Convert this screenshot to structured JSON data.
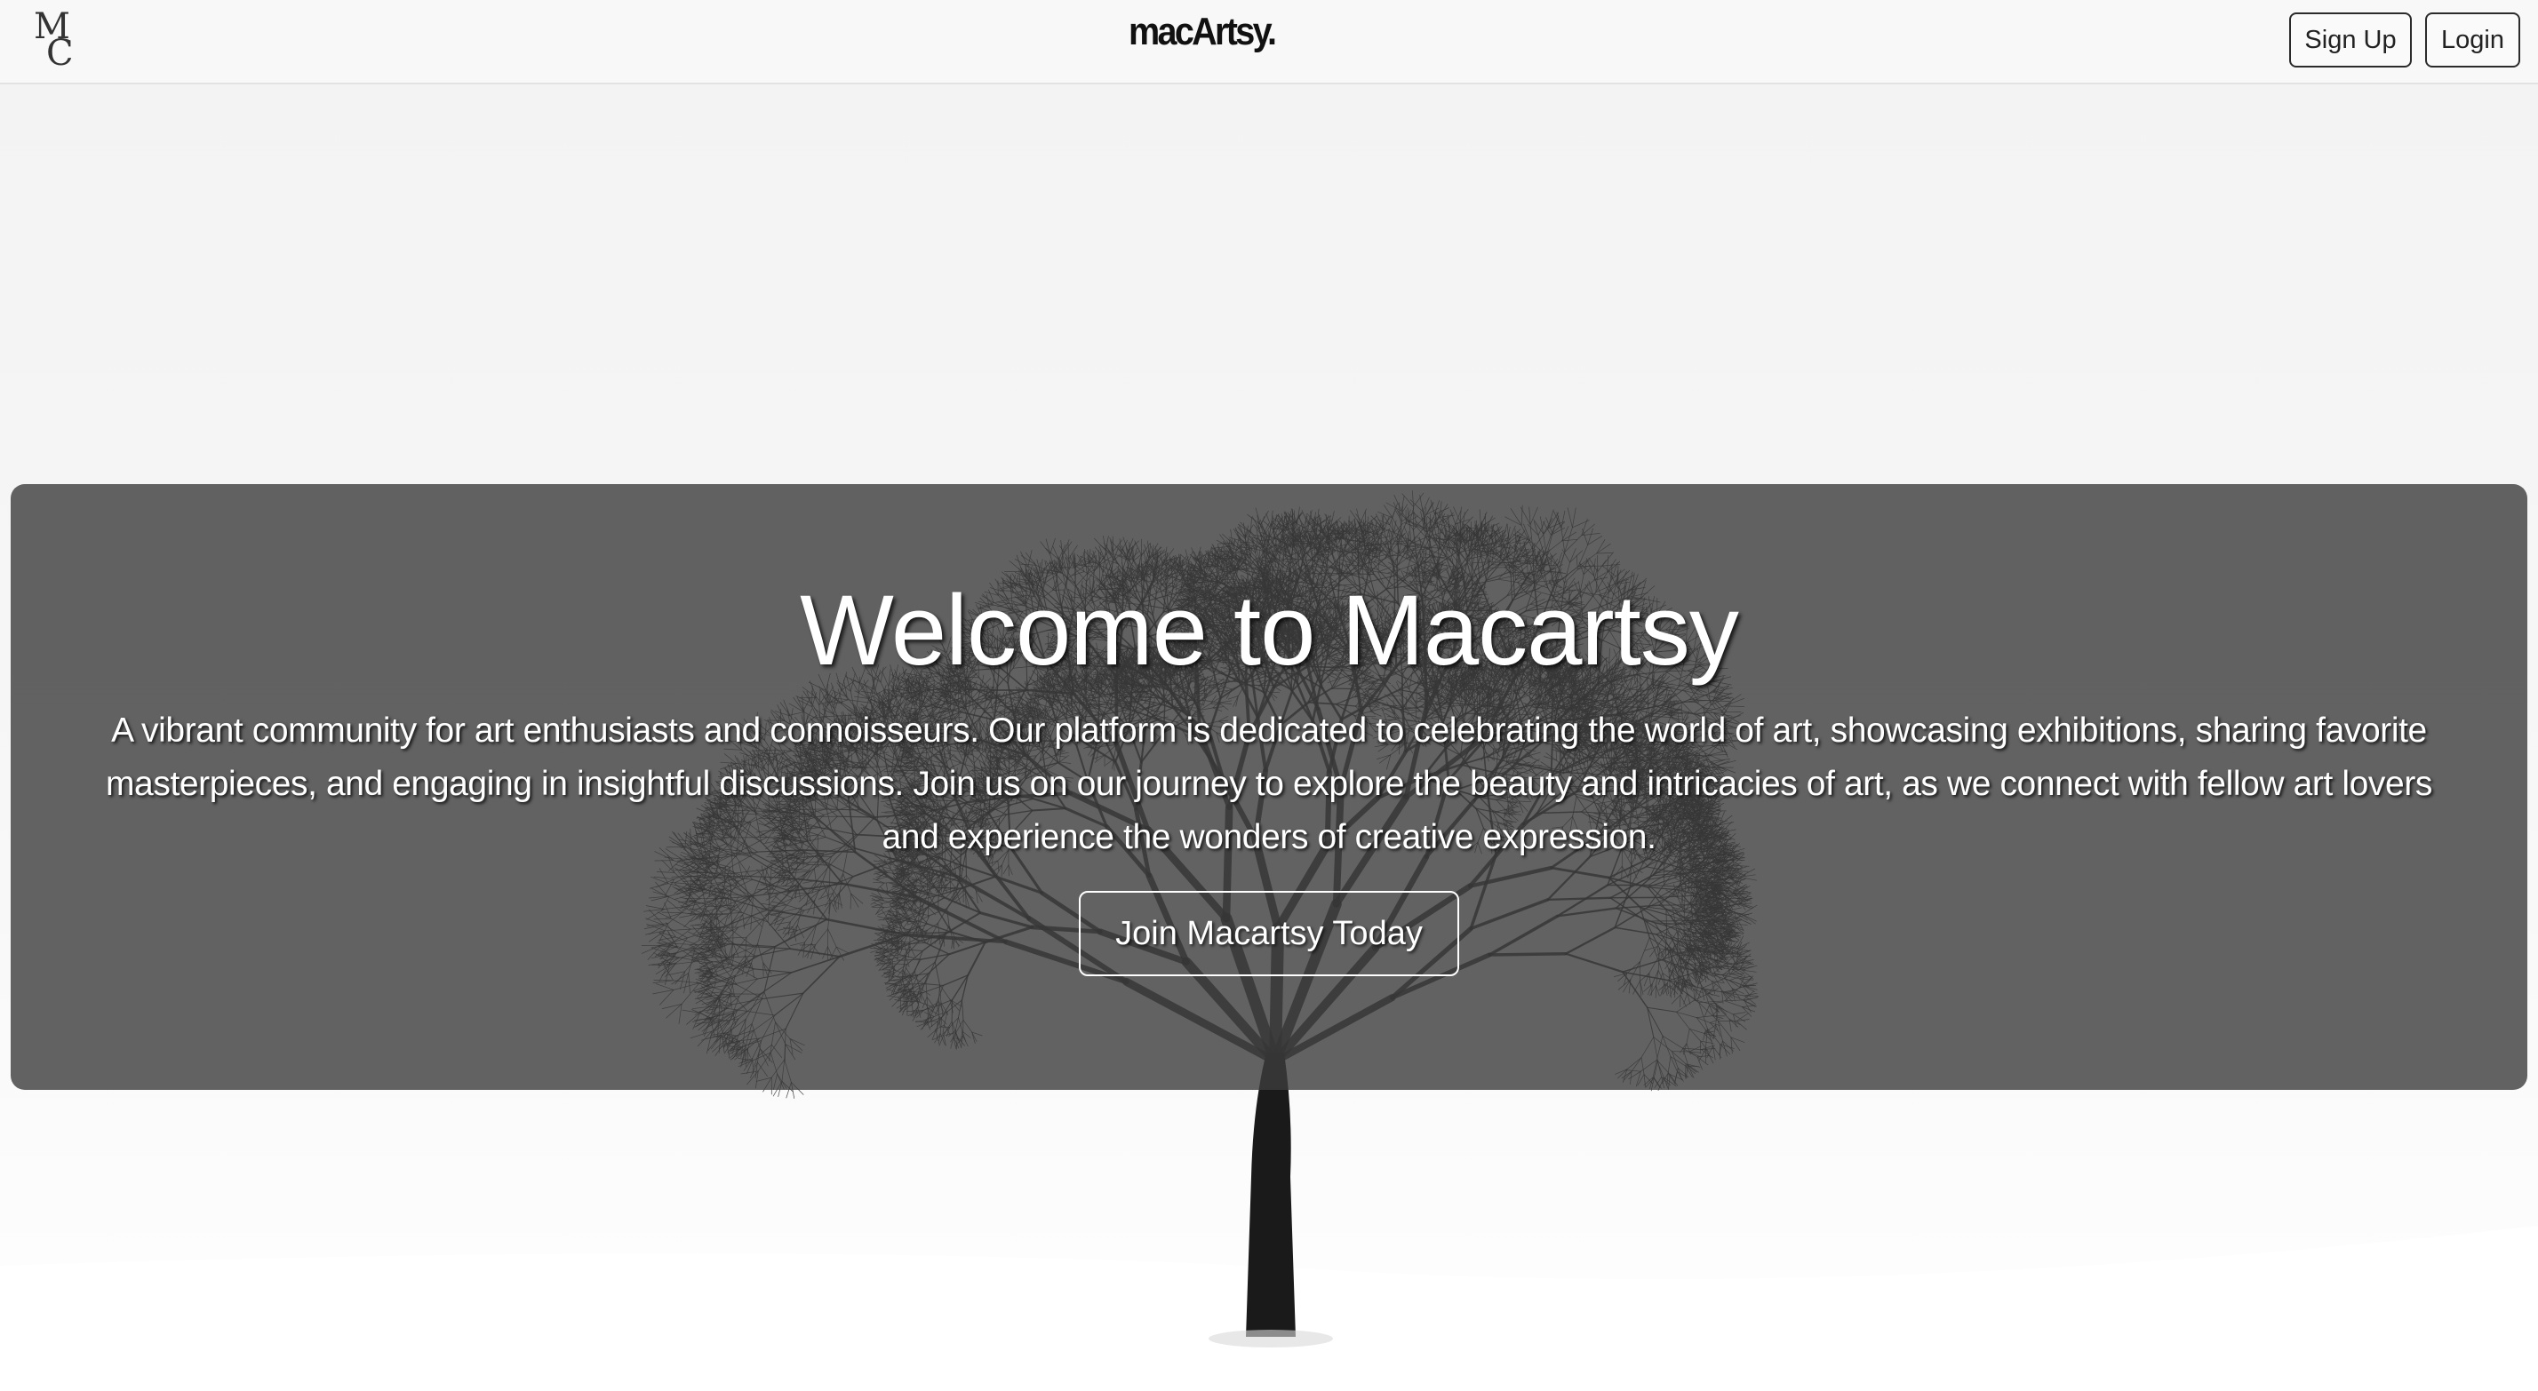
{
  "navbar": {
    "logo_text": "MC",
    "brand": "macArtsy.",
    "signup_label": "Sign Up",
    "login_label": "Login"
  },
  "hero": {
    "title": "Welcome to Macartsy",
    "description": "A vibrant community for art enthusiasts and connoisseurs. Our platform is dedicated to celebrating the world of art, showcasing exhibitions, sharing favorite masterpieces, and engaging in insightful discussions. Join us on our journey to explore the beauty and intricacies of art, as we connect with fellow art lovers and experience the wonders of creative expression.",
    "cta_label": "Join Macartsy Today"
  },
  "background": {
    "subject": "bare-tree-in-snow-photo"
  },
  "colors": {
    "overlay": "#3c3c3c",
    "text_light": "#ffffff",
    "nav_bg": "#f8f8f8"
  }
}
